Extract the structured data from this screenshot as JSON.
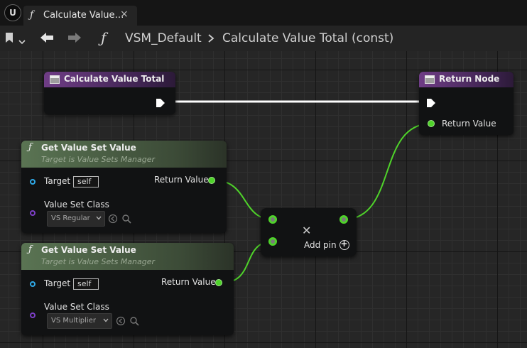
{
  "tab": {
    "title": "Calculate Value…",
    "close": "×",
    "func_glyph": "ƒ"
  },
  "toolbar": {
    "func_glyph": "ƒ",
    "breadcrumb_root": "VSM_Default",
    "breadcrumb_current": "Calculate Value Total (const)"
  },
  "nodes": {
    "entry": {
      "title": "Calculate Value Total"
    },
    "return": {
      "title": "Return Node",
      "pin_return_value": "Return Value"
    },
    "get1": {
      "glyph": "ƒ",
      "title": "Get Value Set Value",
      "subtitle": "Target is Value Sets Manager",
      "pin_target": "Target",
      "target_value": "self",
      "pin_return_value": "Return Value",
      "pin_class": "Value Set Class",
      "class_value": "VS Regular"
    },
    "get2": {
      "glyph": "ƒ",
      "title": "Get Value Set Value",
      "subtitle": "Target is Value Sets Manager",
      "pin_target": "Target",
      "target_value": "self",
      "pin_return_value": "Return Value",
      "pin_class": "Value Set Class",
      "class_value": "VS Multiplier"
    },
    "multiply": {
      "add_pin_label": "Add pin"
    }
  },
  "colors": {
    "event_header": "#6f3d86",
    "function_header": "#5a7453",
    "float_wire": "#4fd32a",
    "exec_wire": "#ffffff",
    "object_pin": "#2fa9e8",
    "class_pin": "#7d3fc7"
  },
  "icons": {
    "logo": "unreal-logo-icon",
    "bookmark": "bookmark-icon",
    "back": "back-arrow-icon",
    "forward": "forward-arrow-icon",
    "breadcrumb_separator": "chevron-right-icon",
    "multiply_node": "multiply-icon",
    "add_pin": "add-circle-icon",
    "browse": "browse-arrow-icon",
    "search": "search-icon"
  }
}
